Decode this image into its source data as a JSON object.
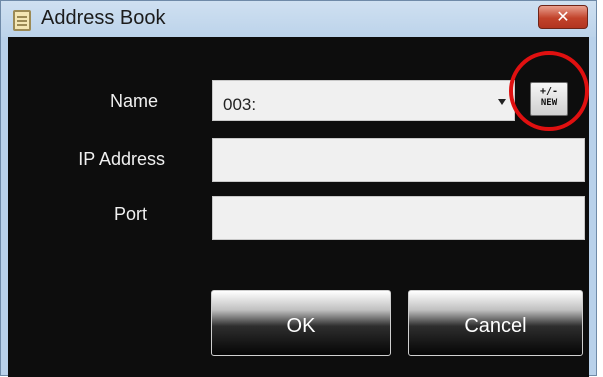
{
  "window": {
    "title": "Address Book",
    "close_label": "✕"
  },
  "form": {
    "name_label": "Name",
    "name_value": "003:",
    "ip_label": "IP Address",
    "ip_value": "",
    "port_label": "Port",
    "port_value": ""
  },
  "new_button": {
    "top_text": "+/-",
    "bottom_text": "NEW"
  },
  "buttons": {
    "ok_label": "OK",
    "cancel_label": "Cancel"
  },
  "colors": {
    "titlebar": "#bcd3ea",
    "content_bg": "#0d0d0d",
    "highlight": "#e01010",
    "close": "#c2432b"
  }
}
